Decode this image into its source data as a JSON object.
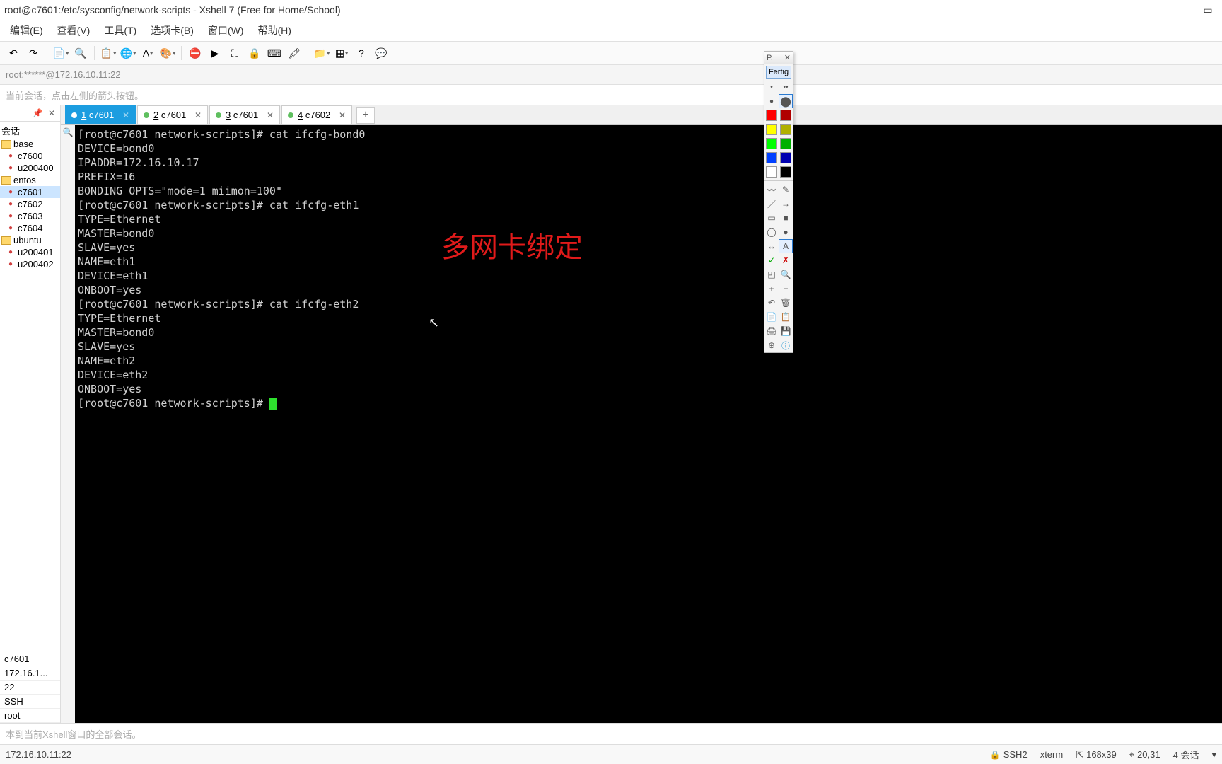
{
  "title": "root@c7601:/etc/sysconfig/network-scripts - Xshell 7 (Free for Home/School)",
  "menus": [
    "编辑(E)",
    "查看(V)",
    "工具(T)",
    "选项卡(B)",
    "窗口(W)",
    "帮助(H)"
  ],
  "address": "root:******@172.16.10.11:22",
  "hint": "当前会话，点击左侧的箭头按钮。",
  "sidebar": {
    "title": "会话",
    "items": [
      {
        "type": "folder",
        "label": "base"
      },
      {
        "type": "host",
        "label": "c7600",
        "lvl": 1
      },
      {
        "type": "host",
        "label": "u200400",
        "lvl": 1
      },
      {
        "type": "folder",
        "label": "entos"
      },
      {
        "type": "host",
        "label": "c7601",
        "lvl": 1,
        "active": true
      },
      {
        "type": "host",
        "label": "c7602",
        "lvl": 1
      },
      {
        "type": "host",
        "label": "c7603",
        "lvl": 1
      },
      {
        "type": "host",
        "label": "c7604",
        "lvl": 1
      },
      {
        "type": "folder",
        "label": "ubuntu"
      },
      {
        "type": "host",
        "label": "u200401",
        "lvl": 1
      },
      {
        "type": "host",
        "label": "u200402",
        "lvl": 1
      }
    ],
    "props": [
      "c7601",
      "172.16.1...",
      "22",
      "SSH",
      "root"
    ]
  },
  "tabs": [
    {
      "num": "1",
      "label": "c7601",
      "active": true
    },
    {
      "num": "2",
      "label": "c7601"
    },
    {
      "num": "3",
      "label": "c7601"
    },
    {
      "num": "4",
      "label": "c7602"
    }
  ],
  "terminal_lines": [
    "[root@c7601 network-scripts]# cat ifcfg-bond0",
    "DEVICE=bond0",
    "IPADDR=172.16.10.17",
    "PREFIX=16",
    "BONDING_OPTS=\"mode=1 miimon=100\"",
    "[root@c7601 network-scripts]# cat ifcfg-eth1",
    "TYPE=Ethernet",
    "MASTER=bond0",
    "SLAVE=yes",
    "NAME=eth1",
    "DEVICE=eth1",
    "ONBOOT=yes",
    "[root@c7601 network-scripts]# cat ifcfg-eth2",
    "TYPE=Ethernet",
    "MASTER=bond0",
    "SLAVE=yes",
    "NAME=eth2",
    "DEVICE=eth2",
    "ONBOOT=yes",
    "[root@c7601 network-scripts]# "
  ],
  "overlay": "多网卡绑定",
  "palette": {
    "title": "P.",
    "fertig": "Fertig"
  },
  "sendbar": "本到当前Xshell窗口的全部会话。",
  "status": {
    "addr": "172.16.10.11:22",
    "proto": "SSH2",
    "term": "xterm",
    "size": "168x39",
    "pos": "20,31",
    "sess": "4 会话"
  },
  "toolbar_icons": [
    "undo-icon",
    "redo-icon",
    "new-session-icon",
    "search-icon",
    "copy-paste-icon",
    "globe-icon",
    "font-icon",
    "theme-icon",
    "stop-icon",
    "go-icon",
    "fullscreen-icon",
    "lock-icon",
    "keyboard-icon",
    "highlight-icon",
    "add-folder-icon",
    "layout-icon",
    "help-icon",
    "balloon-icon"
  ],
  "palette_colors": [
    {
      "type": "size",
      "v": "•",
      "sel": false
    },
    {
      "type": "size",
      "v": "••",
      "sel": false
    },
    {
      "type": "size",
      "v": "●",
      "sel": false
    },
    {
      "type": "size",
      "v": "⬤",
      "sel": true
    },
    {
      "type": "color",
      "c": "#ff0000"
    },
    {
      "type": "color",
      "c": "#b00000"
    },
    {
      "type": "color",
      "c": "#ffff00"
    },
    {
      "type": "color",
      "c": "#b0b000"
    },
    {
      "type": "color",
      "c": "#00ff00"
    },
    {
      "type": "color",
      "c": "#00b000"
    },
    {
      "type": "color",
      "c": "#0040ff"
    },
    {
      "type": "color",
      "c": "#0000b0"
    },
    {
      "type": "color",
      "c": "#ffffff"
    },
    {
      "type": "color",
      "c": "#000000"
    }
  ],
  "palette_tools": [
    "wave",
    "pen",
    "line",
    "arrow",
    "rect-o",
    "rect-f",
    "ellipse-o",
    "ellipse-f",
    "arrow2",
    "text",
    "check",
    "x",
    "crop",
    "zoom",
    "plus",
    "minus",
    "undo",
    "trash",
    "copy",
    "paste",
    "print",
    "save",
    "target",
    "info"
  ]
}
